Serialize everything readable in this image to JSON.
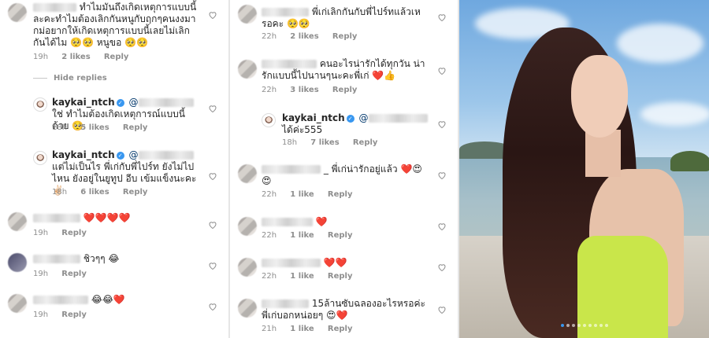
{
  "left": {
    "c1": {
      "text": "ทำไมมันถึงเกิดเหตุการแบบนี้ละคะทำไมต้องเลิกกันหนูกับฤกๆคนงงมากม่อยากให้เกิดเหตุการแบบนี้เลยไม่เลิกกันได้ไม 🥺🥺 หนูขอ 🥺🥺",
      "time": "19h",
      "likes": "2 likes",
      "reply": "Reply"
    },
    "hide_replies": "Hide replies",
    "c2": {
      "user": "kaykai_ntch",
      "mention": "@",
      "text": "ใช่ ทำไมต้องเกิดเหตุการณ์แบบนี้ด้วย 🥺",
      "time": "18h",
      "likes": "5 likes",
      "reply": "Reply"
    },
    "c3": {
      "user": "kaykai_ntch",
      "mention": "@",
      "text": "แต่ไม่เป็นไร พี่เก่กับพี่ไปร์ท ยังไม่ไปไหน ยังอยู่ในยูทูป อีบ เข้มแข็งนะคะ ✌🏻",
      "time": "18h",
      "likes": "6 likes",
      "reply": "Reply"
    },
    "c4": {
      "text": "❤️❤️❤️❤️",
      "time": "19h",
      "reply": "Reply"
    },
    "c5": {
      "text": "ชิวๆๆ 😂",
      "time": "19h",
      "reply": "Reply"
    },
    "c6": {
      "text": "😂😂❤️",
      "time": "19h",
      "reply": "Reply"
    }
  },
  "mid": {
    "c1": {
      "text": "พี่เก่เลิกกันกับพี่ไปร์ทแล้วเหรอคะ 🥺🥺",
      "time": "22h",
      "likes": "2 likes",
      "reply": "Reply"
    },
    "c2": {
      "text": "คนอะไรน่ารักได้ทุกวัน น่ารักแบบนี้ไปนานๆนะคะพี่เก่ ❤️👍",
      "time": "22h",
      "likes": "3 likes",
      "reply": "Reply"
    },
    "c3": {
      "user": "kaykai_ntch",
      "mention": "@",
      "text": "ได้ค่ะ555",
      "time": "18h",
      "likes": "7 likes",
      "reply": "Reply"
    },
    "c4": {
      "text": "_ พี่เก่น่ารักอยู่แล้ว ❤️😍😍",
      "time": "22h",
      "likes": "1 like",
      "reply": "Reply"
    },
    "c5": {
      "text": "❤️",
      "time": "22h",
      "likes": "1 like",
      "reply": "Reply"
    },
    "c6": {
      "text": "❤️❤️",
      "time": "22h",
      "likes": "1 like",
      "reply": "Reply"
    },
    "c7": {
      "text": "15ล้านซับฉลองอะไรหรอค่ะพี่เก่บอกหน่อยๆ 😍❤️",
      "time": "21h",
      "likes": "1 like",
      "reply": "Reply"
    }
  },
  "icons": {
    "like": "heart-outline-icon",
    "verified": "verified-badge-icon"
  },
  "colors": {
    "verified": "#3897f0",
    "meta": "#8e8e8e",
    "heart": "#e0203a"
  },
  "photo": {
    "carousel_count": 9,
    "carousel_active": 0
  }
}
